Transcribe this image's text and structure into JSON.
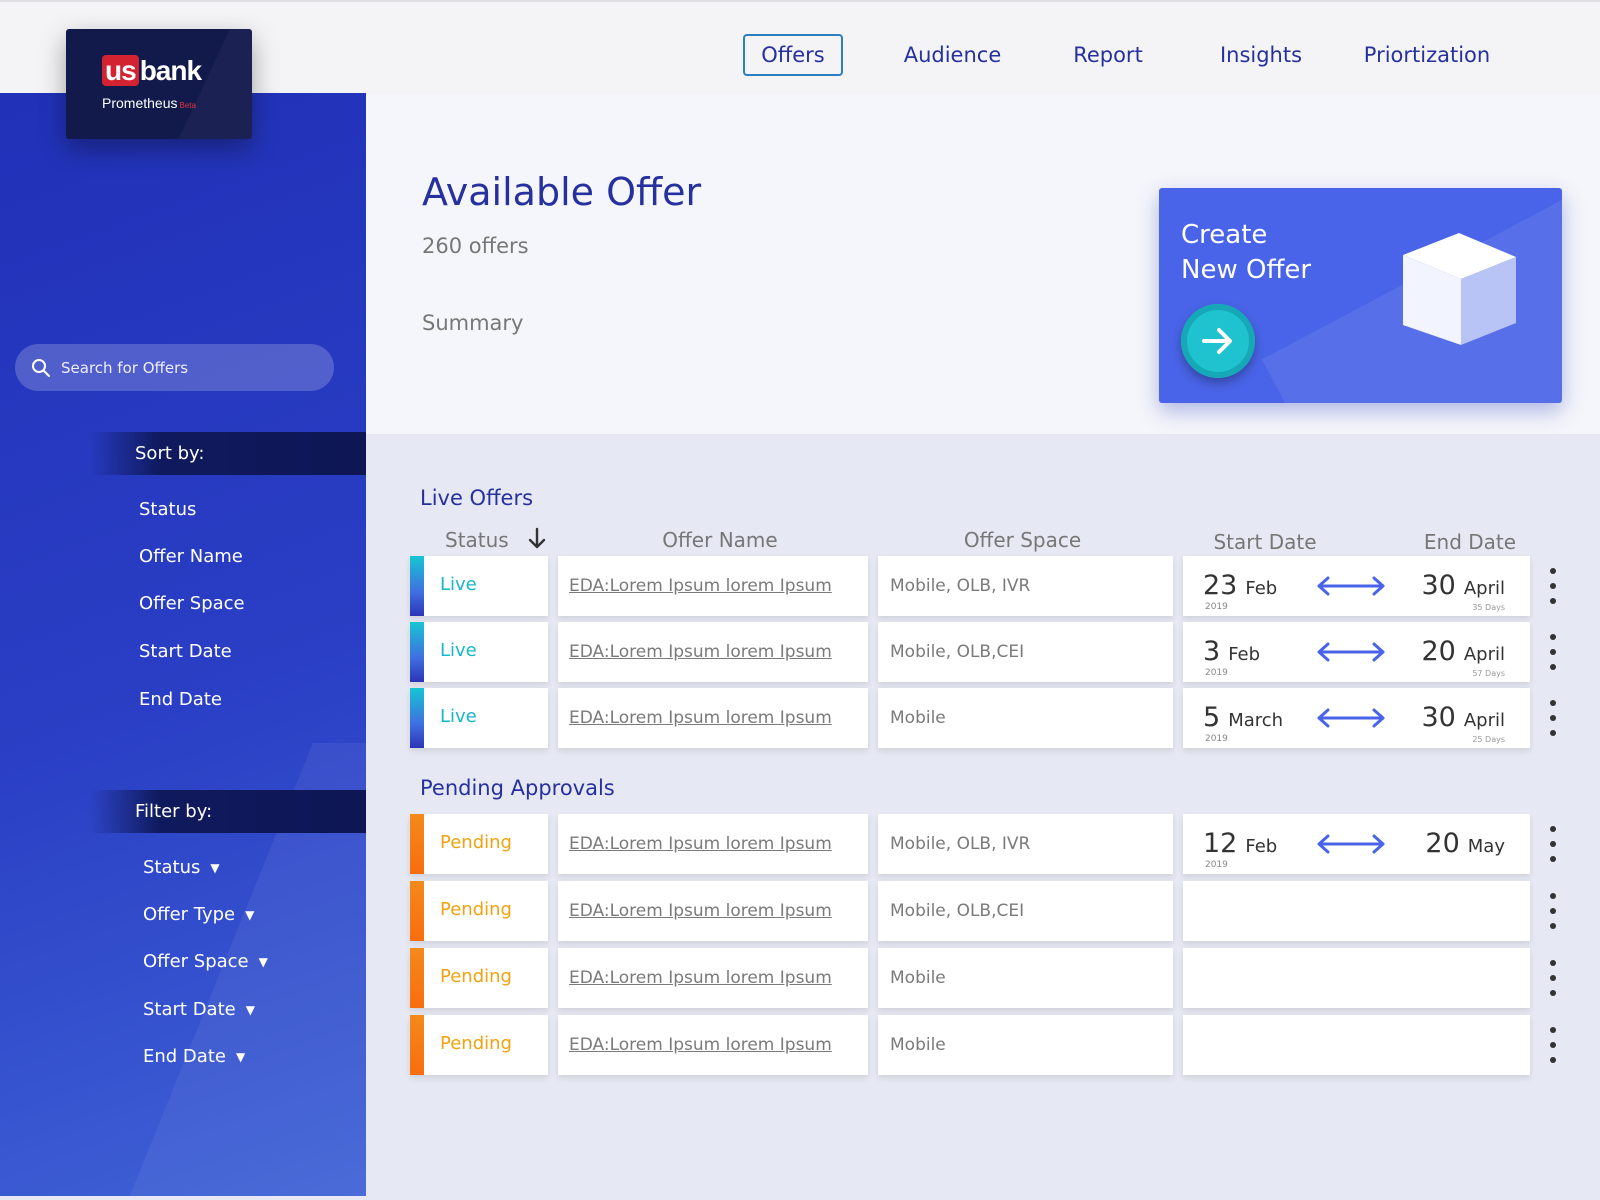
{
  "app": {
    "brand_us": "us",
    "brand_bank": "bank",
    "product": "Prometheus",
    "badge": "Beta"
  },
  "nav": [
    {
      "label": "Offers",
      "active": true
    },
    {
      "label": "Audience"
    },
    {
      "label": "Report"
    },
    {
      "label": "Insights"
    },
    {
      "label": "Priortization"
    }
  ],
  "sidebar": {
    "search_placeholder": "Search for Offers",
    "sort_title": "Sort by:",
    "sort_items": [
      "Status",
      "Offer Name",
      "Offer Space",
      "Start Date",
      "End Date"
    ],
    "filter_title": "Filter by:",
    "filter_items": [
      "Status",
      "Offer Type",
      "Offer Space",
      "Start Date",
      "End Date"
    ],
    "caret": "▼"
  },
  "header": {
    "title": "Available Offer",
    "count": "260 offers",
    "summary": "Summary",
    "create_label_line1": "Create",
    "create_label_line2": "New Offer"
  },
  "columns": [
    "Status",
    "Offer Name",
    "Offer Space",
    "Start Date",
    "End Date"
  ],
  "live_section": {
    "title": "Live Offers",
    "rows": [
      {
        "status": "Live",
        "name": "EDA:Lorem Ipsum lorem Ipsum",
        "space": "Mobile, OLB, IVR",
        "start_day": "23",
        "start_month": "Feb",
        "start_year": "2019",
        "end_day": "30",
        "end_month": "April",
        "duration": "35 Days"
      },
      {
        "status": "Live",
        "name": "EDA:Lorem Ipsum lorem Ipsum",
        "space": "Mobile, OLB,CEI",
        "start_day": "3",
        "start_month": "Feb",
        "start_year": "2019",
        "end_day": "20",
        "end_month": "April",
        "duration": "57 Days"
      },
      {
        "status": "Live",
        "name": "EDA:Lorem Ipsum lorem Ipsum",
        "space": "Mobile",
        "start_day": "5",
        "start_month": "March",
        "start_year": "2019",
        "end_day": "30",
        "end_month": "April",
        "duration": "25 Days"
      }
    ]
  },
  "pending_section": {
    "title": "Pending Approvals",
    "rows": [
      {
        "status": "Pending",
        "name": "EDA:Lorem Ipsum lorem Ipsum",
        "space": "Mobile, OLB, IVR",
        "start_day": "12",
        "start_month": "Feb",
        "start_year": "2019",
        "end_day": "20",
        "end_month": "May"
      },
      {
        "status": "Pending",
        "name": "EDA:Lorem Ipsum lorem Ipsum",
        "space": "Mobile, OLB,CEI"
      },
      {
        "status": "Pending",
        "name": "EDA:Lorem Ipsum lorem Ipsum",
        "space": "Mobile"
      },
      {
        "status": "Pending",
        "name": "EDA:Lorem Ipsum lorem Ipsum",
        "space": "Mobile"
      }
    ]
  },
  "colors": {
    "primary": "#26319e",
    "sidebar": "#2a3fc5",
    "live": "#16b7c7",
    "pending": "#f3a20f",
    "accent": "#4964e8"
  }
}
